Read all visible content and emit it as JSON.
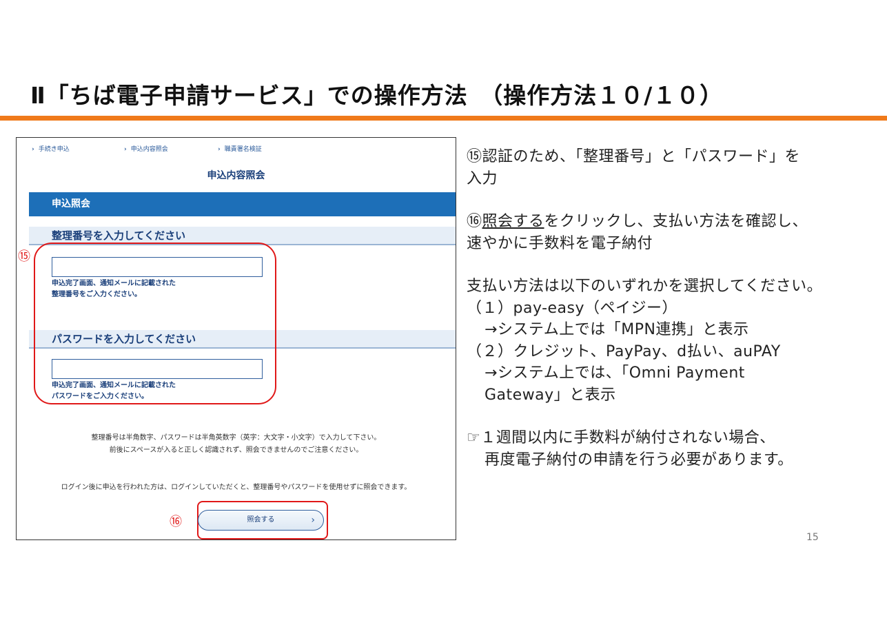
{
  "slide": {
    "title": "Ⅱ「ちば電子申請サービス」での操作方法　（操作方法１０/１０）",
    "page_number": "15",
    "accent_color": "#f07a1a"
  },
  "screenshot": {
    "breadcrumbs": [
      "手続き申込",
      "申込内容照会",
      "職責署名検証"
    ],
    "heading": "申込内容照会",
    "section_bar": "申込照会",
    "ref_field": {
      "label": "整理番号を入力してください",
      "value": "",
      "hint_line1": "申込完了画面、通知メールに記載された",
      "hint_line2": "整理番号をご入力ください。"
    },
    "password_field": {
      "label": "パスワードを入力してください",
      "value": "",
      "hint_line1": "申込完了画面、通知メールに記載された",
      "hint_line2": "パスワードをご入力ください。"
    },
    "note_line1": "整理番号は半角数字、パスワードは半角英数字（英字：大文字・小文字）で入力して下さい。",
    "note_line2": "前後にスペースが入ると正しく認識されず、照会できませんのでご注意ください。",
    "login_note": "ログイン後に申込を行われた方は、ログインしていただくと、整理番号やパスワードを使用せずに照会できます。",
    "submit_label": "照会する",
    "marker_15": "⑮",
    "marker_16": "⑯",
    "highlight_color": "#e01818",
    "brand_color": "#1d6fb8"
  },
  "instructions": {
    "step15": "⑮認証のため、「整理番号」と「パスワード」を",
    "step15_cont": "入力",
    "step16_num": "⑯",
    "step16_link": "照会する",
    "step16_rest": "をクリックし、支払い方法を確認し、",
    "step16_cont": "速やかに手数料を電子納付",
    "pay_intro": "支払い方法は以下のいずれかを選択してください。",
    "pay1": "（１）pay-easy（ペイジー）",
    "pay1_note": "→システム上では「MPN連携」と表示",
    "pay2": "（２）クレジット、PayPay、d払い、auPAY",
    "pay2_note": "→システム上では、「Omni Payment",
    "pay2_note_cont": "Gateway」と表示",
    "warning": "☞１週間以内に手数料が納付されない場合、",
    "warning_cont": "再度電子納付の申請を行う必要があります。"
  }
}
